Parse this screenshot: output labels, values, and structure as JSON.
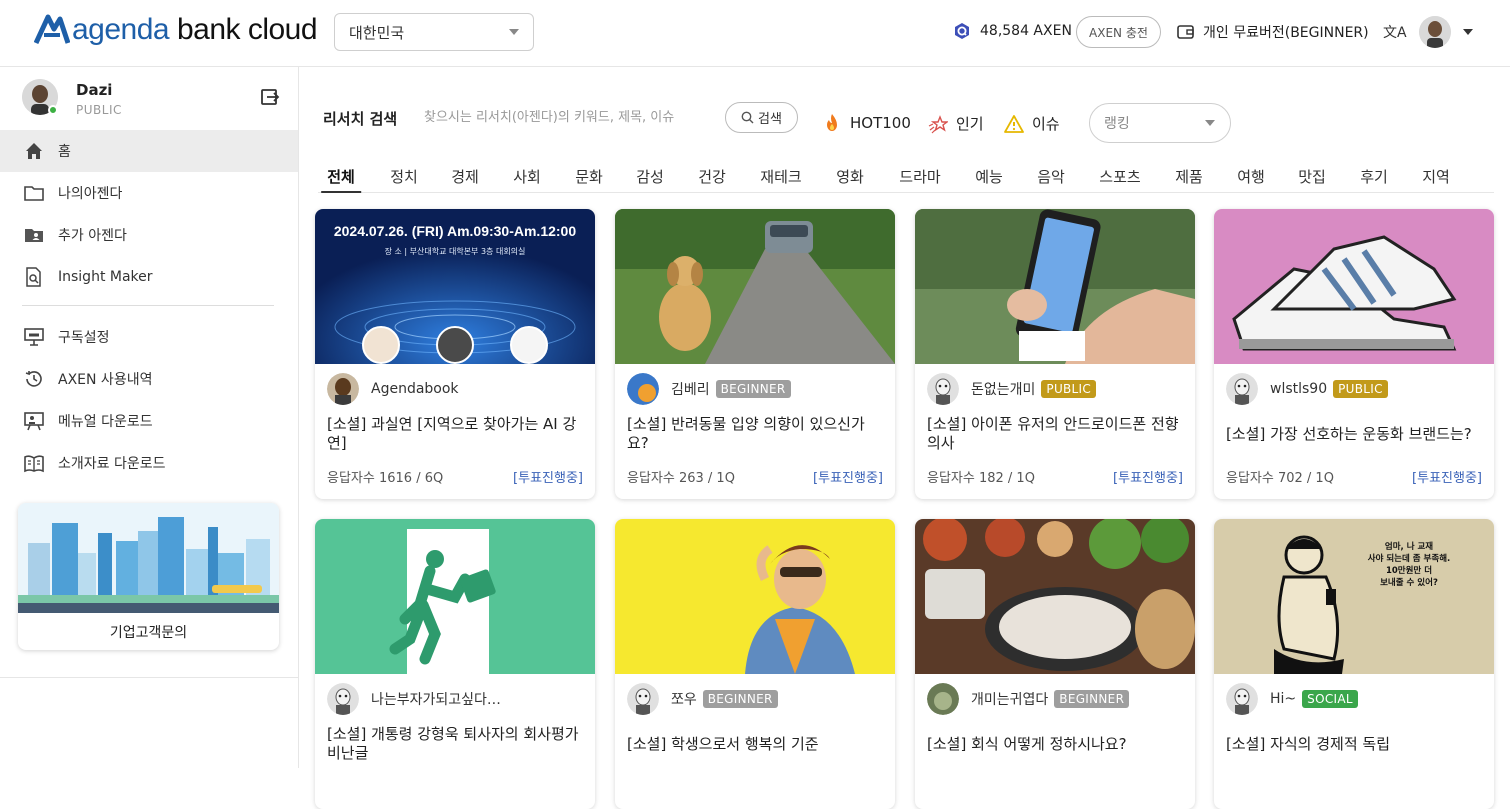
{
  "header": {
    "logo_prefix": "agenda",
    "logo_suffix": " bank cloud",
    "region": "대한민국",
    "axen_balance": "48,584 AXEN",
    "axen_charge": "AXEN 충전",
    "plan": "개인 무료버전(BEGINNER)",
    "translate_icon": "文A"
  },
  "profile": {
    "name": "Dazi",
    "status": "PUBLIC"
  },
  "nav": [
    {
      "label": "홈",
      "icon": "home-icon"
    },
    {
      "label": "나의아젠다",
      "icon": "folder-icon"
    },
    {
      "label": "추가 아젠다",
      "icon": "folder-user-icon"
    },
    {
      "label": "Insight Maker",
      "icon": "document-search-icon"
    },
    {
      "label": "구독설정",
      "icon": "presentation-icon"
    },
    {
      "label": "AXEN 사용내역",
      "icon": "history-icon"
    },
    {
      "label": "메뉴얼 다운로드",
      "icon": "board-icon"
    },
    {
      "label": "소개자료 다운로드",
      "icon": "book-icon"
    }
  ],
  "promo": {
    "label": "기업고객문의"
  },
  "search": {
    "label": "리서치 검색",
    "placeholder": "찾으시는 리서치(아젠다)의 키워드, 제목, 이슈",
    "button": "검색"
  },
  "quick": {
    "hot": "HOT100",
    "popular": "인기",
    "issue": "이슈"
  },
  "ranking": {
    "placeholder": "랭킹"
  },
  "tabs": [
    "전체",
    "정치",
    "경제",
    "사회",
    "문화",
    "감성",
    "건강",
    "재테크",
    "영화",
    "드라마",
    "예능",
    "음악",
    "스포츠",
    "제품",
    "여행",
    "맛집",
    "후기",
    "지역"
  ],
  "cards": [
    {
      "author": "Agendabook",
      "badge": "",
      "title": "[소셜] 과실연 [지역으로 찾아가는 AI 강연]",
      "meta": "응답자수 1616 / 6Q",
      "status": "[투표진행중]",
      "img_text": "2024.07.26. (FRI) Am.09:30-Am.12:00",
      "img_sub": "장 소  |  부산대학교 대학본부 3층 대회의실"
    },
    {
      "author": "김베리",
      "badge": "BEGINNER",
      "title": "[소셜] 반려동물 입양 의향이 있으신가요?",
      "meta": "응답자수 263 / 1Q",
      "status": "[투표진행중]"
    },
    {
      "author": "돈없는개미",
      "badge": "PUBLIC",
      "title": "[소셜] 아이폰 유저의 안드로이드폰 전향 의사",
      "meta": "응답자수 182 / 1Q",
      "status": "[투표진행중]"
    },
    {
      "author": "wlstls90",
      "badge": "PUBLIC",
      "title": "[소셜] 가장 선호하는 운동화 브랜드는?",
      "meta": "응답자수 702 / 1Q",
      "status": "[투표진행중]"
    },
    {
      "author": "나는부자가되고싶다…",
      "badge": "",
      "title": "[소셜] 개통령 강형욱 퇴사자의 회사평가 비난글",
      "meta": "",
      "status": ""
    },
    {
      "author": "쪼우",
      "badge": "BEGINNER",
      "title": "[소셜] 학생으로서 행복의 기준",
      "meta": "",
      "status": ""
    },
    {
      "author": "개미는귀엽다",
      "badge": "BEGINNER",
      "title": "[소셜] 회식 어떻게 정하시나요?",
      "meta": "",
      "status": ""
    },
    {
      "author": "Hi~",
      "badge": "SOCIAL",
      "title": "[소셜] 자식의 경제적 독립",
      "meta": "",
      "status": "",
      "img_text": "엄마, 나 교재\n사야 되는데 좀 부족해.\n10만원만 더\n보내줄 수 있어?"
    }
  ],
  "colors": {
    "brand_blue": "#1e5fa8",
    "public_badge": "#c29a1a",
    "beginner_badge": "#9e9e9e",
    "social_badge": "#3aa64b",
    "vote_link": "#3b63b8"
  }
}
